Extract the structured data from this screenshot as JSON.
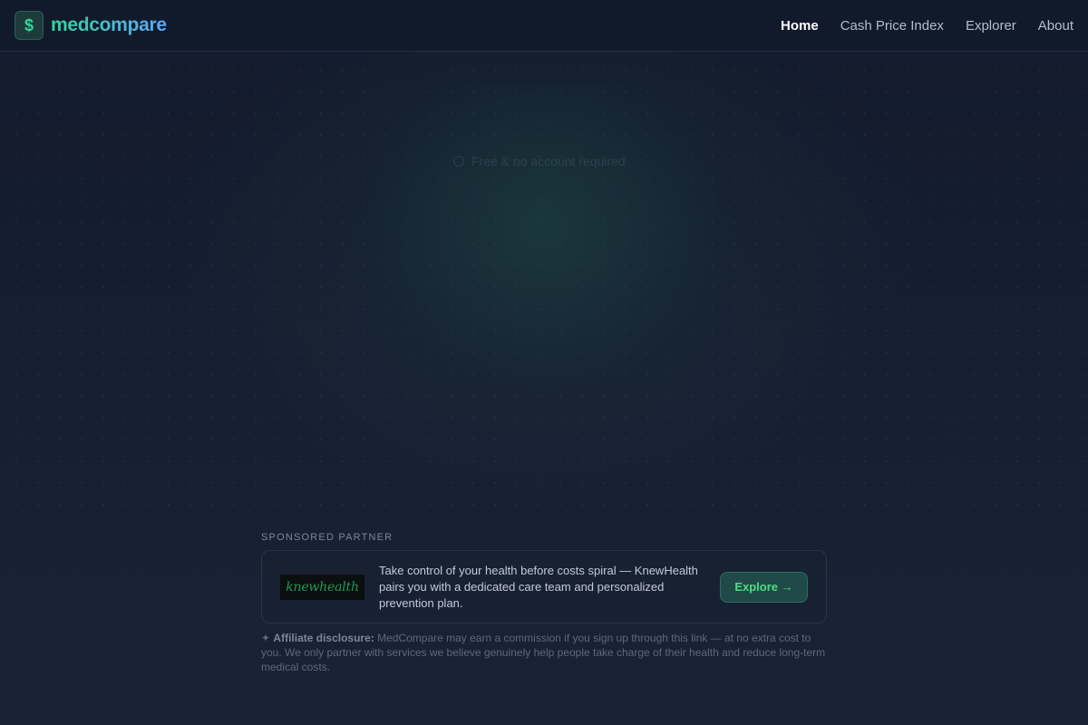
{
  "brand": {
    "logo_glyph": "$",
    "name": "medcompare",
    "accent_from": "#34d399",
    "accent_to": "#60a5fa"
  },
  "nav": {
    "items": [
      {
        "label": "Home",
        "active": true
      },
      {
        "label": "Cash Price Index",
        "active": false
      },
      {
        "label": "Explorer",
        "active": false
      },
      {
        "label": "About",
        "active": false
      }
    ]
  },
  "hero": {
    "faded_note": "Free & no account required"
  },
  "sponsored": {
    "label": "SPONSORED PARTNER",
    "partner_logo_text": "knewhealth",
    "description": "Take control of your health before costs spiral — KnewHealth pairs you with a dedicated care team and personalized prevention plan.",
    "cta_label": "Explore →",
    "disclosure_icon": "✦",
    "disclosure_title": "Affiliate disclosure:",
    "disclosure_body": " MedCompare may earn a commission if you sign up through this link — at no extra cost to you. We only partner with services we believe genuinely help people take charge of their health and reduce long-term medical costs."
  }
}
